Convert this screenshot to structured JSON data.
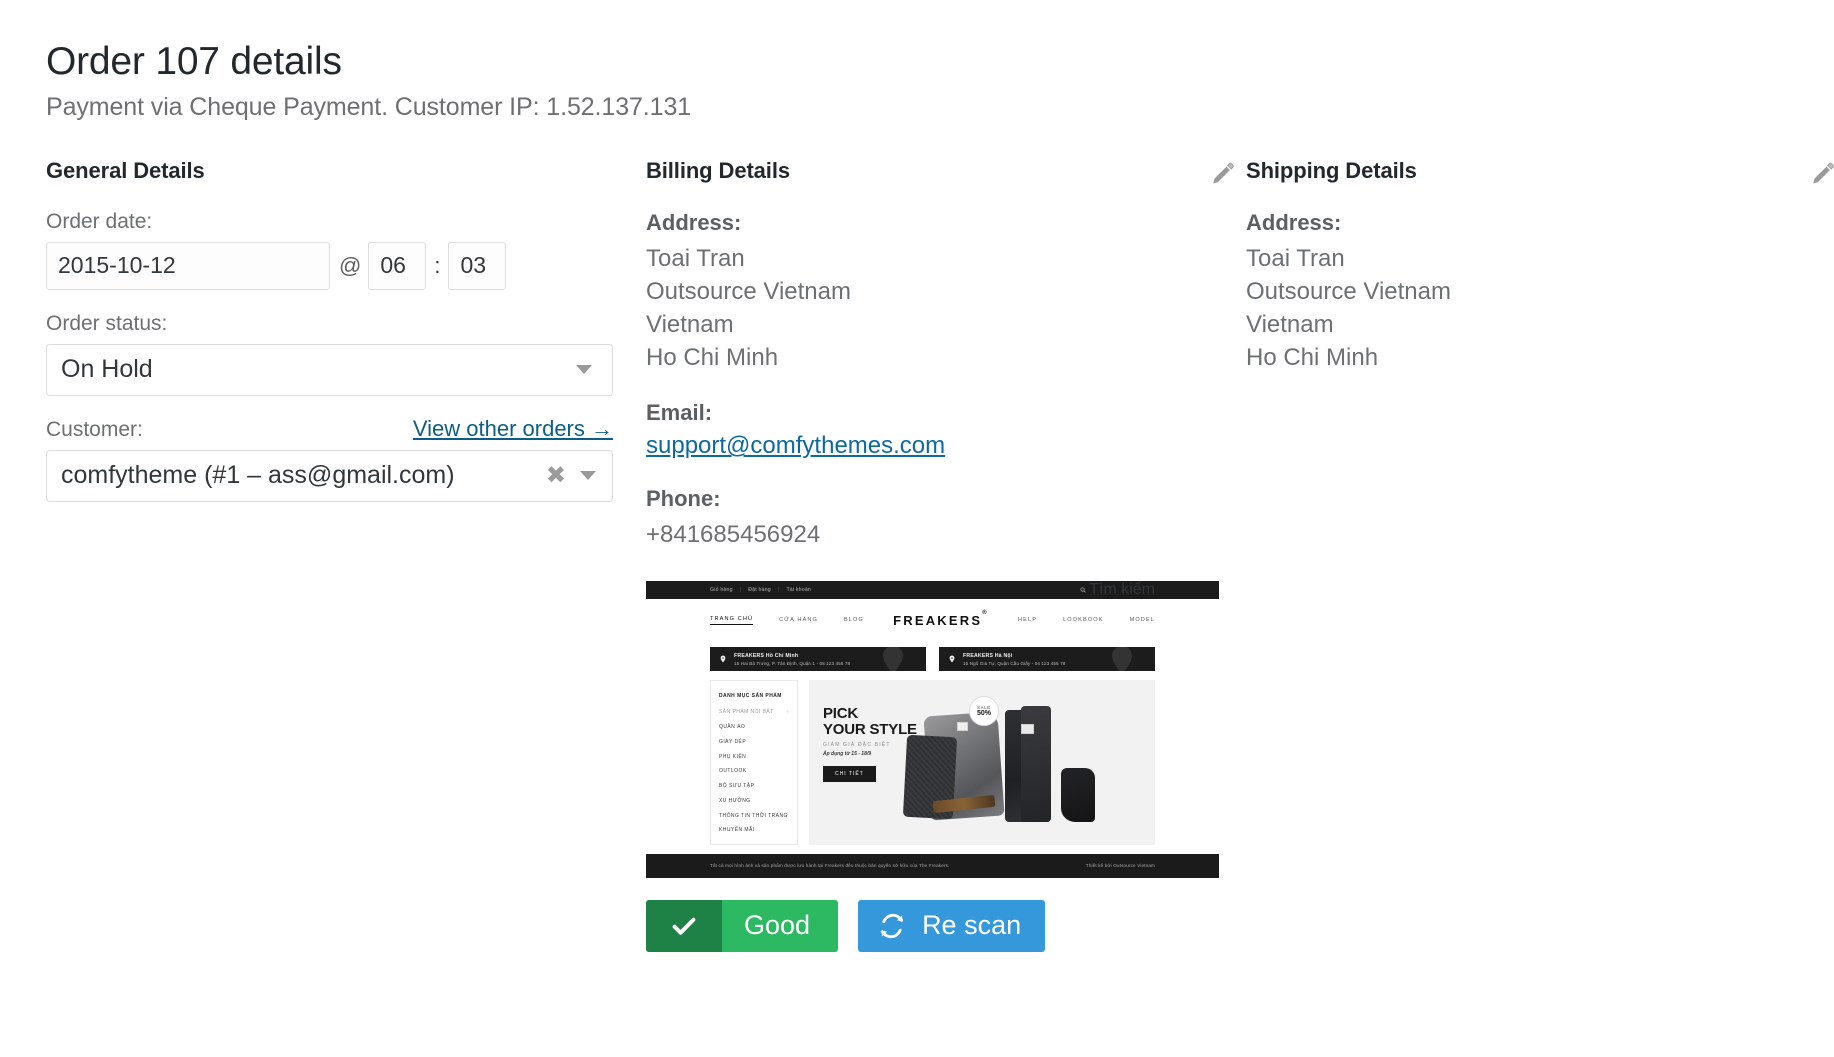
{
  "header": {
    "title": "Order 107 details",
    "subtitle": "Payment via Cheque Payment. Customer IP: 1.52.137.131"
  },
  "general": {
    "heading": "General Details",
    "order_date_label": "Order date:",
    "order_date_value": "2015-10-12",
    "at_symbol": "@",
    "hour_value": "06",
    "colon": ":",
    "minute_value": "03",
    "order_status_label": "Order status:",
    "order_status_value": "On Hold",
    "customer_label": "Customer:",
    "view_other_orders": "View other orders →",
    "customer_value": "comfytheme (#1 – ass@gmail.com)",
    "clear_symbol": "✖"
  },
  "billing": {
    "heading": "Billing Details",
    "address_label": "Address:",
    "address_lines": [
      "Toai Tran",
      "Outsource Vietnam",
      "Vietnam",
      "Ho Chi Minh"
    ],
    "email_label": "Email:",
    "email_value": "support@comfythemes.com",
    "phone_label": "Phone:",
    "phone_value": "+841685456924"
  },
  "shipping": {
    "heading": "Shipping Details",
    "address_label": "Address:",
    "address_lines": [
      "Toai Tran",
      "Outsource Vietnam",
      "Vietnam",
      "Ho Chi Minh"
    ]
  },
  "site_preview": {
    "topbar": {
      "links": [
        "Giỏ hàng",
        "Đặt hàng",
        "Tài khoản"
      ],
      "separator": "|",
      "search_label": "Tìm kiếm"
    },
    "nav_left": [
      "TRANG CHỦ",
      "CỬA HÀNG",
      "BLOG"
    ],
    "logo": "FREAKERS",
    "logo_mark": "®",
    "nav_right": [
      "HELP",
      "LOOKBOOK",
      "MODEL"
    ],
    "stores": [
      {
        "name": "FREAKERS Hồ Chí Minh",
        "address": "15 Hai Bà Trưng, P. Tân Định, Quận 1  -  08 123 456 78"
      },
      {
        "name": "FREAKERS Hà Nội",
        "address": "15 Ngô Gia Tự, Quận Cầu Giấy  -  04 123 456 78"
      }
    ],
    "sidebar": {
      "heading": "DANH MỤC SẢN PHẨM",
      "items": [
        "SẢN PHẨM NỔI BẬT",
        "QUẦN ÁO",
        "GIÀY DÉP",
        "PHỤ KIỆN",
        "OUTLOOK",
        "BỘ SƯU TẬP",
        "XU HƯỚNG",
        "THÔNG TIN THỜI TRANG",
        "KHUYẾN MÃI"
      ],
      "submenu_arrow": "›"
    },
    "hero": {
      "title_line1": "PICK",
      "title_line2": "YOUR STYLE",
      "subtitle": "GIẢM GIÁ ĐẶC BIỆT",
      "subtitle2": "Áp dụng từ 15 - 18/9",
      "button": "CHI TIẾT",
      "badge_top": "SALE",
      "badge_bottom": "50%"
    },
    "footer": {
      "left": "Tất cả mọi hình ảnh và sản phẩm được lưu hành tại Freakers đều thuộc bản quyền sở hữu của The Freakers.",
      "right": "Thiết kế bởi Outsource Vietnam"
    }
  },
  "actions": {
    "good_label": "Good",
    "rescan_label": "Re scan"
  },
  "colors": {
    "link": "#0c5e87",
    "good_green": "#2cb962",
    "good_green_dark": "#1e8246",
    "rescan_blue": "#3498db"
  }
}
